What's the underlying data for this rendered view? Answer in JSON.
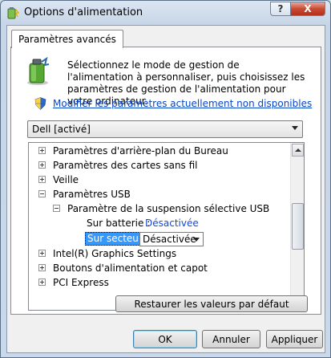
{
  "window": {
    "title": "Options d'alimentation",
    "help_label": "?",
    "close_label": "X"
  },
  "tab": {
    "label": "Paramètres avancés"
  },
  "info": {
    "description": "Sélectionnez le mode de gestion de l'alimentation à personnaliser, puis choisissez les paramètres de gestion de l'alimentation pour votre ordinateur."
  },
  "link": {
    "text": "Modifier les paramètres actuellement non disponibles"
  },
  "plan_select": {
    "value": "Dell [activé]"
  },
  "tree": {
    "items": [
      {
        "label": "Paramètres d'arrière-plan du Bureau",
        "state": "collapsed"
      },
      {
        "label": "Paramètres des cartes sans fil",
        "state": "collapsed"
      },
      {
        "label": "Veille",
        "state": "collapsed"
      },
      {
        "label": "Paramètres USB",
        "state": "expanded"
      },
      {
        "label": "Paramètre de la suspension sélective USB",
        "state": "expanded"
      },
      {
        "label": "Intel(R) Graphics Settings",
        "state": "collapsed"
      },
      {
        "label": "Boutons d'alimentation et capot",
        "state": "collapsed"
      },
      {
        "label": "PCI Express",
        "state": "collapsed"
      }
    ],
    "battery_label": "Sur batterie :",
    "battery_value": "Désactivée",
    "ac_label": "Sur secteur :",
    "ac_value": "Désactivée"
  },
  "buttons": {
    "restore": "Restaurer les valeurs par défaut",
    "ok": "OK",
    "cancel": "Annuler",
    "apply": "Appliquer"
  },
  "colors": {
    "link": "#0645c8",
    "selection": "#3399ff",
    "close": "#c94a33"
  }
}
